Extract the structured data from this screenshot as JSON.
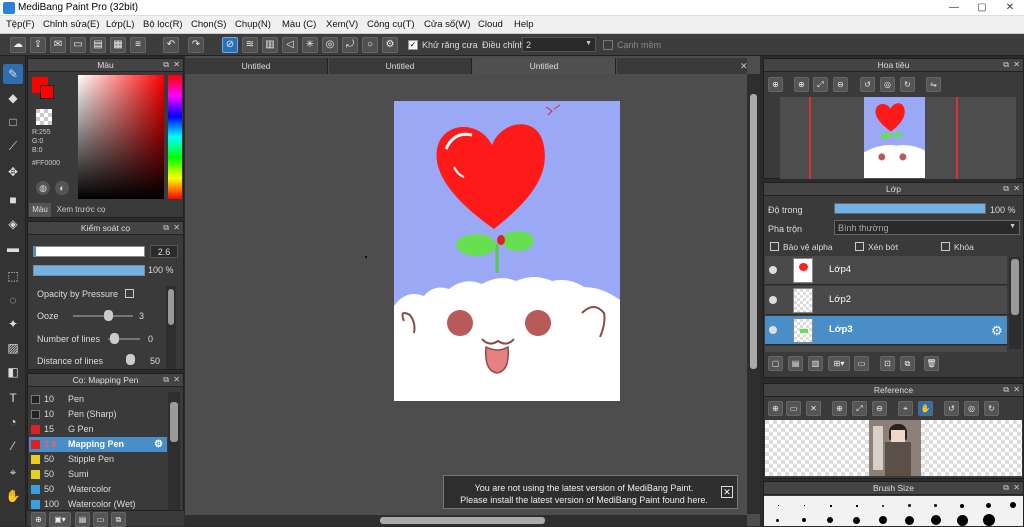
{
  "window": {
    "title": "MediBang Paint Pro (32bit)"
  },
  "menu": [
    "Tệp(F)",
    "Chỉnh sửa(E)",
    "Lớp(L)",
    "Bộ lọc(R)",
    "Chọn(S)",
    "Chụp(N)",
    "Màu (C)",
    "Xem(V)",
    "Công cụ(T)",
    "Cửa sổ(W)",
    "Cloud",
    "Help"
  ],
  "toolbar": {
    "antialias_label": "Khử răng cưa",
    "adjust_label": "Điều chỉnh",
    "adjust_value": "2",
    "soft_edge_label": "Cạnh mềm"
  },
  "tabs": [
    "Untitled",
    "Untitled",
    "Untitled"
  ],
  "color_panel": {
    "title": "Màu",
    "r": "R:255",
    "g": "G:0",
    "b": "B:0",
    "hex": "#FF0000",
    "tab_color": "Màu",
    "tab_preview": "Xem trước cọ",
    "primary_color": "#ff0000"
  },
  "brush_control": {
    "title": "Kiểm soát cọ",
    "size_value": "2.6",
    "opacity_value": "100 %",
    "opacity_pressure_label": "Opacity by Pressure",
    "ooze_label": "Ooze",
    "ooze_value": "3",
    "lines_label": "Number of lines",
    "lines_value": "0",
    "distance_label": "Distance of lines",
    "distance_value": "50"
  },
  "brush_list": {
    "title": "Cọ: Mapping Pen",
    "items": [
      {
        "size": "10",
        "name": "Pen",
        "color": "#222222"
      },
      {
        "size": "10",
        "name": "Pen (Sharp)",
        "color": "#222222"
      },
      {
        "size": "15",
        "name": "G Pen",
        "color": "#e02020"
      },
      {
        "size": "2.6",
        "name": "Mapping Pen",
        "color": "#e02020"
      },
      {
        "size": "50",
        "name": "Stipple Pen",
        "color": "#e8d020"
      },
      {
        "size": "50",
        "name": "Sumi",
        "color": "#e8d020"
      },
      {
        "size": "50",
        "name": "Watercolor",
        "color": "#3aa0e0"
      },
      {
        "size": "100",
        "name": "Watercolor (Wet)",
        "color": "#3aa0e0"
      }
    ]
  },
  "navigator": {
    "title": "Hoa tiêu"
  },
  "layer_panel": {
    "title": "Lớp",
    "opacity_label": "Độ trong",
    "opacity_value": "100 %",
    "opacity_fraction": 1.0,
    "blend_label": "Pha trộn",
    "blend_value": "Bình thường",
    "protect_alpha": "Bảo vệ alpha",
    "clipping": "Xén bớt",
    "lock": "Khóa",
    "layers": [
      "Lớp4",
      "Lớp2",
      "Lớp3"
    ]
  },
  "reference": {
    "title": "Reference"
  },
  "brush_size": {
    "title": "Brush Size"
  },
  "notification": {
    "line1": "You are not using the latest version of MediBang Paint.",
    "line2": "Please install the latest version of MediBang Paint found here."
  }
}
